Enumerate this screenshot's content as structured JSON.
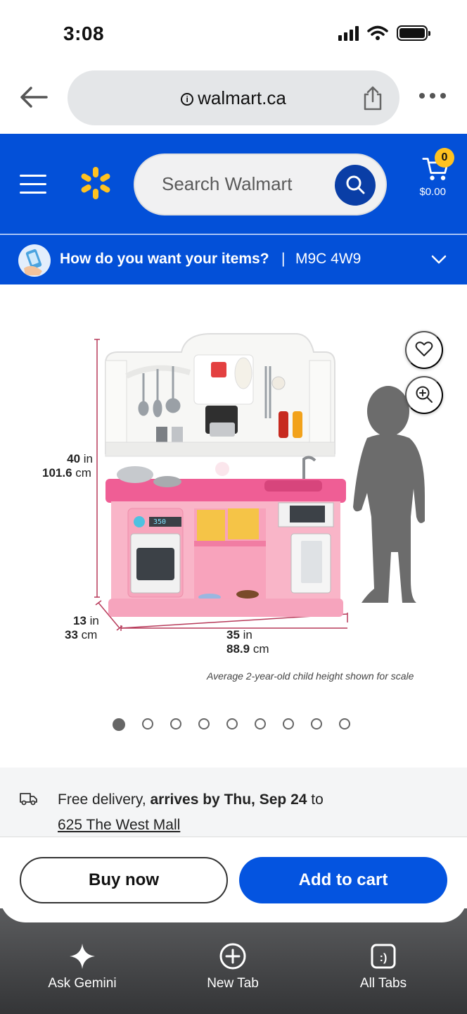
{
  "status_bar": {
    "time": "3:08"
  },
  "browser": {
    "url": "walmart.ca"
  },
  "header": {
    "search_placeholder": "Search Walmart",
    "cart_count": "0",
    "cart_total": "$0.00",
    "brand_color": "#0350d8",
    "spark_color": "#ffc220"
  },
  "fulfillment": {
    "question": "How do you want your items?",
    "separator": "|",
    "postal_code": "M9C 4W9"
  },
  "product_image": {
    "height_in": "40",
    "height_in_unit": "in",
    "height_cm": "101.6",
    "height_cm_unit": "cm",
    "depth_in": "13",
    "depth_in_unit": "in",
    "depth_cm": "33",
    "depth_cm_unit": "cm",
    "width_in": "35",
    "width_in_unit": "in",
    "width_cm": "88.9",
    "width_cm_unit": "cm",
    "oven_display": "350",
    "scale_note": "Average 2-year-old child height shown for scale",
    "carousel_total": 9,
    "carousel_active": 1
  },
  "delivery": {
    "prefix": "Free delivery, ",
    "arrival": "arrives by Thu, Sep 24",
    "suffix": " to",
    "address": "625 The West Mall"
  },
  "actions": {
    "buy_now": "Buy now",
    "add_to_cart": "Add to cart"
  },
  "toolbar": {
    "ask_gemini": "Ask Gemini",
    "new_tab": "New Tab",
    "all_tabs": "All Tabs",
    "all_tabs_icon_text": ":)"
  }
}
